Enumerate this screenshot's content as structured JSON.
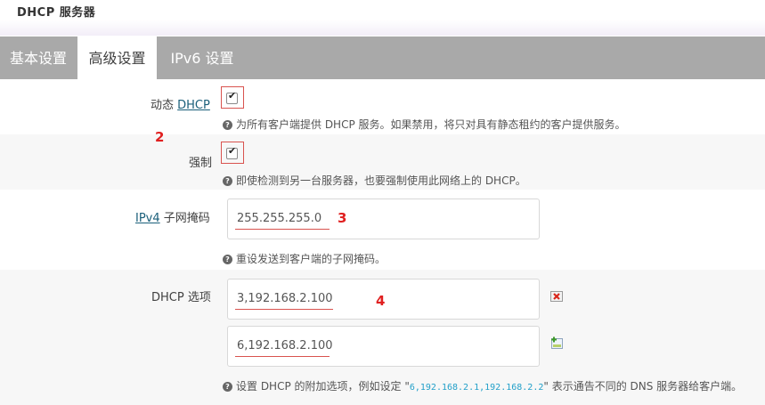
{
  "section": {
    "title": "DHCP 服务器"
  },
  "tabs": [
    {
      "label": "基本设置"
    },
    {
      "label": "高级设置"
    },
    {
      "label": "IPv6 设置"
    }
  ],
  "dynamic_dhcp": {
    "label_prefix": "动态 ",
    "label_link": "DHCP",
    "checked": true,
    "help": "为所有客户端提供 DHCP 服务。如果禁用，将只对具有静态租约的客户提供服务。"
  },
  "force": {
    "label": "强制",
    "checked": true,
    "help": "即使检测到另一台服务器，也要强制使用此网络上的 DHCP。"
  },
  "netmask": {
    "label_link": "IPv4",
    "label_suffix": " 子网掩码",
    "value": "255.255.255.0",
    "help": "重设发送到客户端的子网掩码。"
  },
  "dhcp_options": {
    "label": "DHCP 选项",
    "values": [
      "3,192.168.2.100",
      "6,192.168.2.100"
    ],
    "help_prefix": "设置 DHCP 的附加选项，例如设定 \"",
    "help_code": "6,192.168.2.1,192.168.2.2",
    "help_suffix": "\" 表示通告不同的 DNS 服务器给客户端。"
  },
  "annotations": {
    "n2": "2",
    "n3": "3",
    "n4": "4"
  },
  "icons": {
    "help": "help-circle-icon",
    "remove": "remove-icon",
    "add": "add-icon"
  },
  "colors": {
    "tabbar": "#a9a9a9",
    "annotation": "#e02020",
    "link": "#1a5f7a",
    "code": "#23a0c9"
  }
}
